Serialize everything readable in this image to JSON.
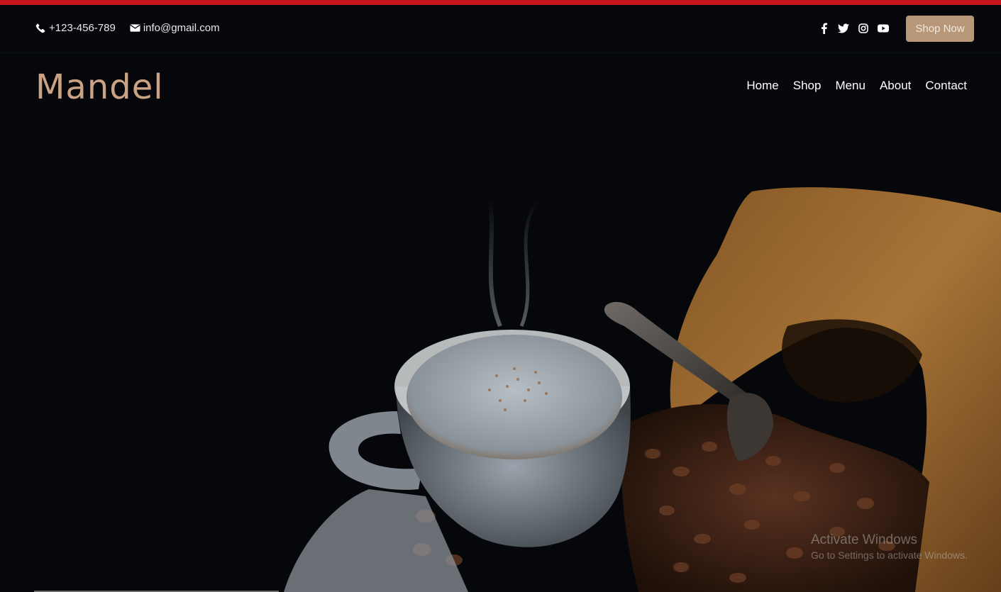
{
  "topbar": {
    "phone": "+123-456-789",
    "email": "info@gmail.com",
    "socials": [
      "facebook-icon",
      "twitter-icon",
      "instagram-icon",
      "youtube-icon"
    ],
    "shop_button": "Shop Now"
  },
  "header": {
    "logo": "Mandel",
    "menu": [
      "Home",
      "Shop",
      "Menu",
      "About",
      "Contact"
    ]
  },
  "watermark": {
    "title": "Activate Windows",
    "subtitle": "Go to Settings to activate Windows."
  },
  "colors": {
    "accent_red": "#c8161d",
    "brand_tan": "#c9a383",
    "button_bg": "#b79778",
    "background": "#05070b"
  }
}
